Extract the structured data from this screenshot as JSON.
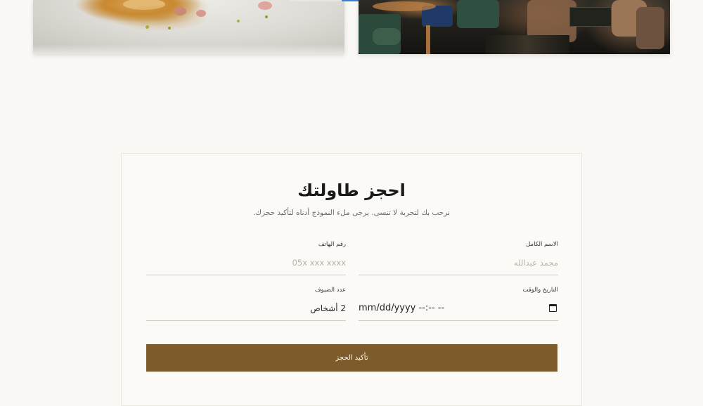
{
  "gallery": {
    "images": [
      "dessert-plate-photo",
      "restaurant-interior-photo"
    ]
  },
  "reservation": {
    "title": "احجز طاولتك",
    "subtitle": "نرحب بك لتجربة لا تنسى. يرجى ملء النموذج أدناه لتأكيد حجزك.",
    "fields": {
      "full_name": {
        "label": "الاسم الكامل",
        "placeholder": "محمد عبدالله"
      },
      "phone": {
        "label": "رقم الهاتف",
        "placeholder": "05x xxx xxxx"
      },
      "datetime": {
        "label": "التاريخ والوقت",
        "value": "mm/dd/yyyy --:-- --",
        "icon": "calendar-icon"
      },
      "guests": {
        "label": "عدد الضيوف",
        "value": "2 أشخاص"
      }
    },
    "submit_label": "تأكيد الحجز"
  },
  "colors": {
    "background": "#f9f8f5",
    "accent": "#7d5b2a",
    "text": "#1a1a1a"
  }
}
